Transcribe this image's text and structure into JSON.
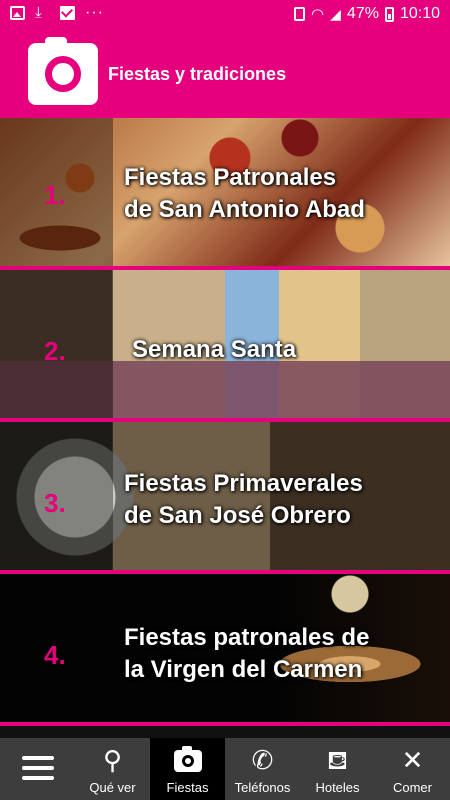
{
  "status_bar": {
    "battery": "47%",
    "time": "10:10"
  },
  "header": {
    "title": "Fiestas y tradiciones"
  },
  "items": [
    {
      "number": "1.",
      "name": "Fiestas Patronales\nde San Antonio Abad"
    },
    {
      "number": "2.",
      "name": "Semana Santa"
    },
    {
      "number": "3.",
      "name": "Fiestas Primaverales\nde San José Obrero"
    },
    {
      "number": "4.",
      "name": "Fiestas patronales de\nla Virgen del Carmen"
    }
  ],
  "nav": [
    {
      "label": "",
      "icon": "menu-icon"
    },
    {
      "label": "Qué ver",
      "icon": "binoculars-icon"
    },
    {
      "label": "Fiestas",
      "icon": "camera-icon",
      "active": true
    },
    {
      "label": "Teléfonos",
      "icon": "phone-icon"
    },
    {
      "label": "Hoteles",
      "icon": "bed-icon"
    },
    {
      "label": "Comer",
      "icon": "cutlery-icon"
    }
  ],
  "colors": {
    "accent": "#e6007e",
    "nav_bg": "#3d3d3d"
  }
}
